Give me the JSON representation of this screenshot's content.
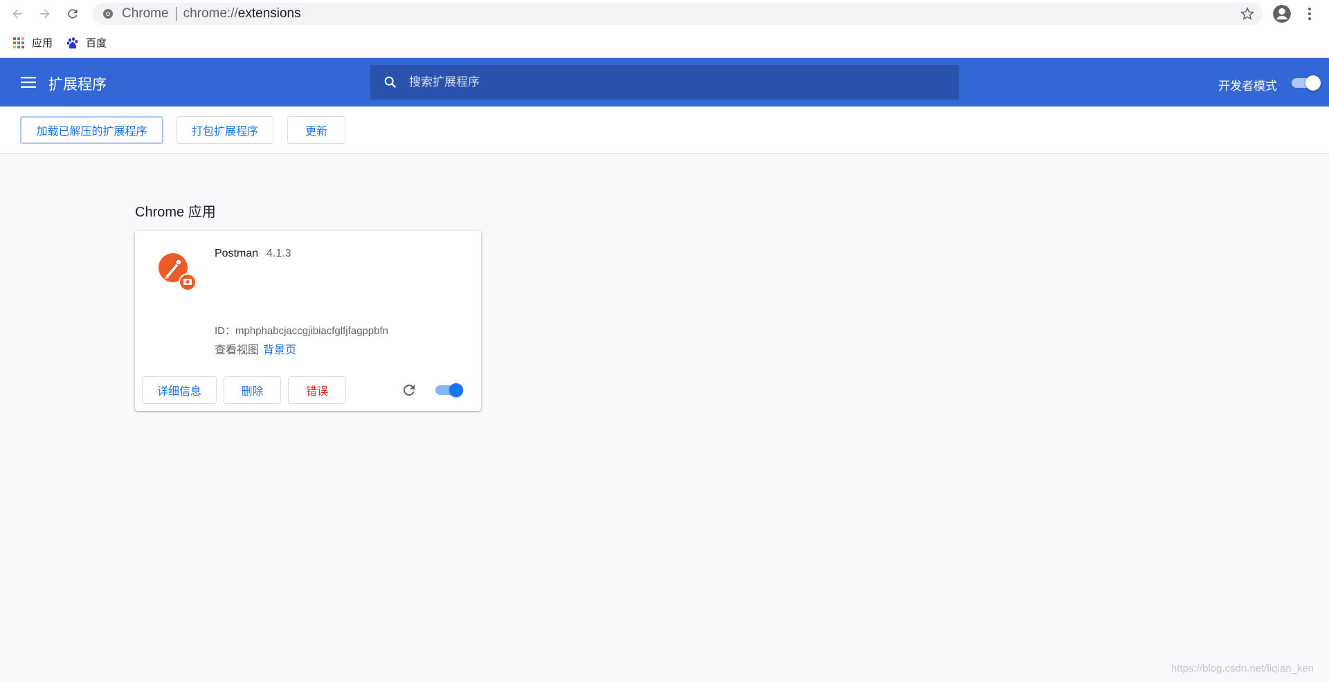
{
  "browser": {
    "scheme_label": "Chrome",
    "url_prefix": "chrome://",
    "url_path": "extensions"
  },
  "bookmarks": [
    {
      "label": "应用",
      "icon": "apps-grid-icon"
    },
    {
      "label": "百度",
      "icon": "baidu-paw-icon"
    }
  ],
  "header": {
    "title": "扩展程序",
    "search_placeholder": "搜索扩展程序",
    "dev_mode_label": "开发者模式",
    "dev_mode_on": true
  },
  "toolbar": {
    "load_unpacked_label": "加载已解压的扩展程序",
    "pack_label": "打包扩展程序",
    "update_label": "更新"
  },
  "section": {
    "title": "Chrome 应用"
  },
  "extension": {
    "name": "Postman",
    "version": "4.1.3",
    "id_label": "ID：",
    "id_value": "mphphabcjaccgjibiacfglfjfagppbfn",
    "views_label": "查看视图",
    "views_link": "背景页",
    "details_label": "详细信息",
    "remove_label": "删除",
    "errors_label": "错误",
    "enabled": true
  },
  "watermark": "https://blog.csdn.net/liqian_ken",
  "colors": {
    "header_bg": "#3367d6",
    "search_bg": "#2a53ad",
    "accent": "#1a73e8",
    "error": "#d93025",
    "postman_orange": "#ef5b25"
  }
}
